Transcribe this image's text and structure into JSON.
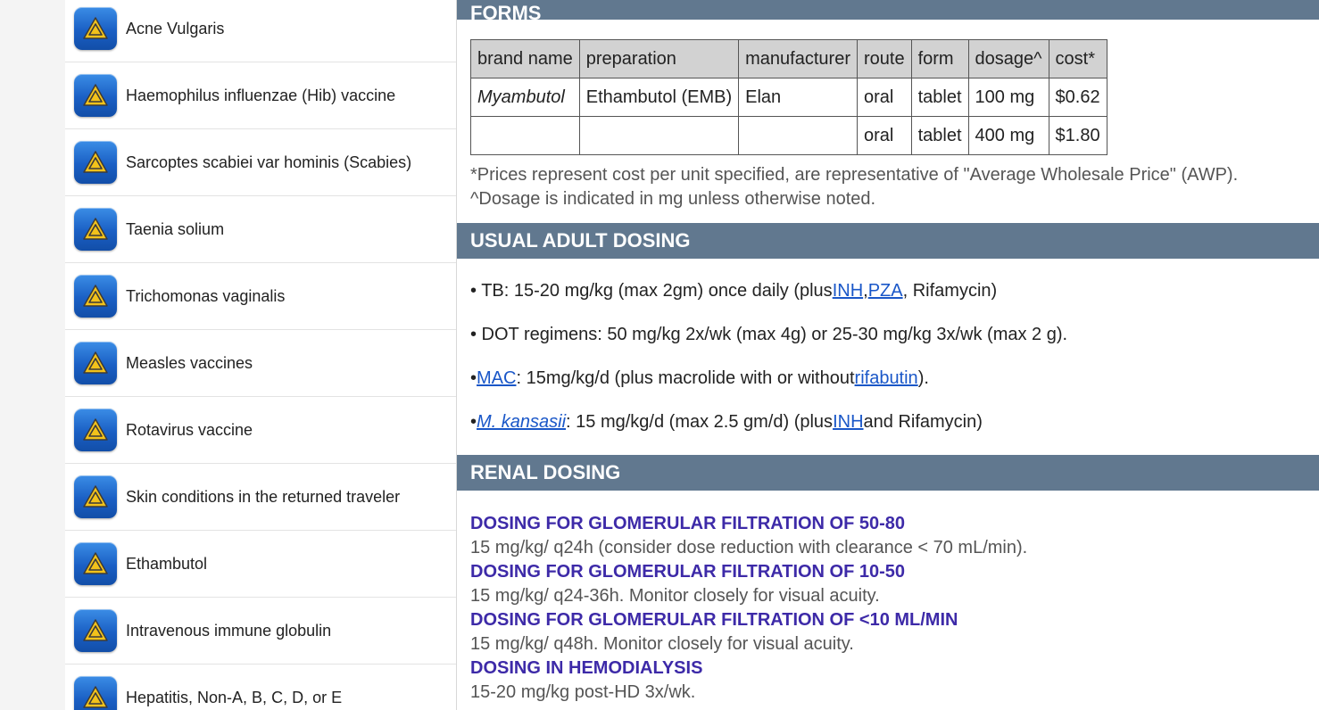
{
  "sidebar": {
    "items": [
      {
        "label": "Acne Vulgaris"
      },
      {
        "label": "Haemophilus influenzae (Hib) vaccine"
      },
      {
        "label": "Sarcoptes scabiei var hominis (Scabies)"
      },
      {
        "label": "Taenia solium"
      },
      {
        "label": "Trichomonas vaginalis"
      },
      {
        "label": "Measles vaccines"
      },
      {
        "label": "Rotavirus vaccine"
      },
      {
        "label": "Skin conditions in the returned traveler"
      },
      {
        "label": "Ethambutol"
      },
      {
        "label": "Intravenous immune globulin"
      },
      {
        "label": "Hepatitis, Non-A, B, C, D, or E"
      }
    ],
    "icon": "warning-triangle-icon"
  },
  "forms": {
    "title": "FORMS",
    "columns": [
      "brand name",
      "preparation",
      "manufacturer",
      "route",
      "form",
      "dosage^",
      "cost*"
    ],
    "rows": [
      [
        "Myambutol",
        "Ethambutol (EMB)",
        "Elan",
        "oral",
        "tablet",
        "100 mg",
        "$0.62"
      ],
      [
        "",
        "",
        "",
        "oral",
        "tablet",
        "400 mg",
        "$1.80"
      ]
    ],
    "note_price": "*Prices represent cost per unit specified, are representative of \"Average Wholesale Price\" (AWP).",
    "note_dosage": "^Dosage is indicated in mg unless otherwise noted."
  },
  "adult_dosing": {
    "title": "USUAL ADULT DOSING",
    "b1": {
      "pre": "• TB: 15-20 mg/kg (max 2gm) once daily (plus ",
      "link1": "INH",
      "sep": ", ",
      "link2": "PZA",
      "post": ", Rifamycin)"
    },
    "b2": {
      "text": "• DOT regimens: 50 mg/kg 2x/wk (max 4g) or 25-30 mg/kg 3x/wk (max 2 g)."
    },
    "b3": {
      "pre": "• ",
      "link1": "MAC",
      "mid": ": 15mg/kg/d (plus macrolide with or without ",
      "link2": "rifabutin",
      "post": ")."
    },
    "b4": {
      "pre": "• ",
      "link1": "M. kansasii",
      "mid": ": 15 mg/kg/d (max 2.5 gm/d) (plus ",
      "link2": "INH",
      "post": " and Rifamycin)"
    }
  },
  "renal_dosing": {
    "title": "RENAL DOSING",
    "entries": [
      {
        "heading": "DOSING FOR GLOMERULAR FILTRATION OF 50-80",
        "text": "15 mg/kg/ q24h (consider dose reduction with clearance < 70 mL/min)."
      },
      {
        "heading": "DOSING FOR GLOMERULAR FILTRATION OF 10-50",
        "text": "15 mg/kg/ q24-36h. Monitor closely for visual acuity."
      },
      {
        "heading": "DOSING FOR GLOMERULAR FILTRATION OF <10 ML/MIN",
        "text": "15 mg/kg/ q48h. Monitor closely for visual acuity."
      },
      {
        "heading": "DOSING IN HEMODIALYSIS",
        "text": "15-20 mg/kg post-HD 3x/wk."
      }
    ]
  },
  "colors": {
    "section_header": "#61788f",
    "link": "#1a57c8",
    "renal_heading": "#3d2aa8"
  }
}
